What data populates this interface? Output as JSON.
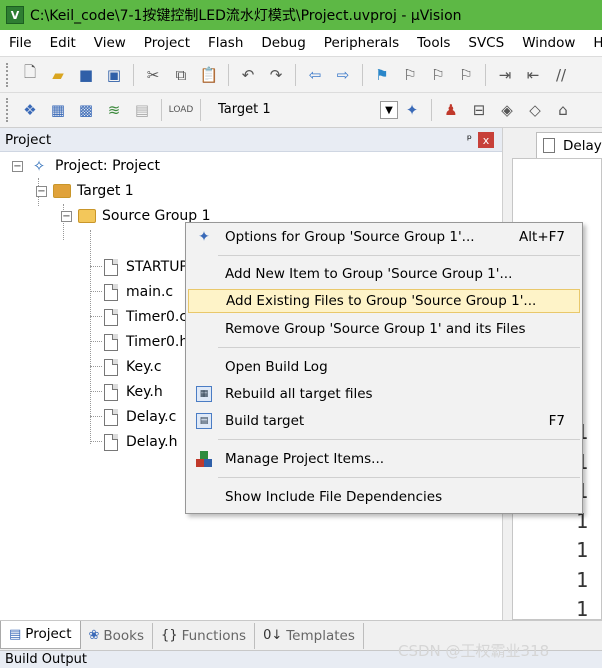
{
  "window": {
    "title": "C:\\Keil_code\\7-1按键控制LED流水灯模式\\Project.uvproj - µVision"
  },
  "menubar": {
    "items": [
      "File",
      "Edit",
      "View",
      "Project",
      "Flash",
      "Debug",
      "Peripherals",
      "Tools",
      "SVCS",
      "Window",
      "H"
    ]
  },
  "toolbar2": {
    "target_value": "Target 1"
  },
  "project_panel": {
    "title": "Project",
    "pin": "ᵖ",
    "close": "x"
  },
  "tree": {
    "root": "Project: Project",
    "target": "Target 1",
    "group": "Source Group 1",
    "files": [
      "STARTUP",
      "main.c",
      "Timer0.c",
      "Timer0.h",
      "Key.c",
      "Key.h",
      "Delay.c",
      "Delay.h"
    ]
  },
  "editor": {
    "tab_label": "Delay",
    "line_digits": [
      "1",
      "1",
      "1",
      "1",
      "1",
      "1",
      "1"
    ],
    "scroll_arrow": "<"
  },
  "context_menu": {
    "items": [
      {
        "label": "Options for Group 'Source Group 1'...",
        "shortcut": "Alt+F7",
        "icon": "options-icon"
      },
      {
        "label": "Add New  Item to Group 'Source Group 1'...",
        "shortcut": "",
        "icon": ""
      },
      {
        "label": "Add Existing Files to Group 'Source Group 1'...",
        "shortcut": "",
        "icon": ""
      },
      {
        "label": "Remove Group 'Source Group 1' and its Files",
        "shortcut": "",
        "icon": ""
      },
      {
        "label": "Open Build Log",
        "shortcut": "",
        "icon": ""
      },
      {
        "label": "Rebuild all target files",
        "shortcut": "",
        "icon": "rebuild-icon"
      },
      {
        "label": "Build target",
        "shortcut": "F7",
        "icon": "build-icon"
      },
      {
        "label": "Manage Project Items...",
        "shortcut": "",
        "icon": "manage-items-icon"
      },
      {
        "label": "Show Include File Dependencies",
        "shortcut": "",
        "icon": ""
      }
    ],
    "highlighted_index": 2
  },
  "bottom_tabs": [
    {
      "label": "Project",
      "active": true
    },
    {
      "label": "Books",
      "active": false
    },
    {
      "label": "Functions",
      "active": false
    },
    {
      "label": "Templates",
      "active": false
    }
  ],
  "build_output": {
    "title": "Build Output"
  },
  "watermark": "CSDN @王权霸业318",
  "colors": {
    "titlebar": "#5db845",
    "menu_highlight": "#fef3c8",
    "panel_header": "#e8ecf3"
  }
}
